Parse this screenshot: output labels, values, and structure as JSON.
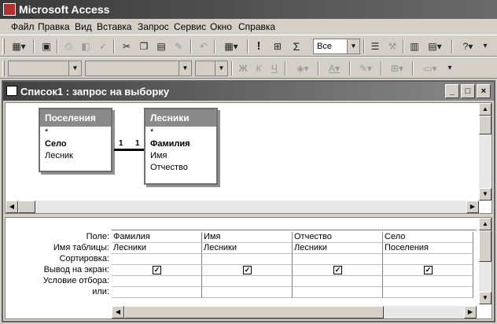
{
  "app": {
    "title": "Microsoft Access"
  },
  "menu": [
    {
      "label": "Файл"
    },
    {
      "label": "Правка"
    },
    {
      "label": "Вид"
    },
    {
      "label": "Вставка"
    },
    {
      "label": "Запрос"
    },
    {
      "label": "Сервис"
    },
    {
      "label": "Окно"
    },
    {
      "label": "Справка"
    }
  ],
  "toolbar": {
    "query_type": "Все",
    "sigma": "Σ",
    "run": "!"
  },
  "format_toolbar": {
    "bold": "Ж",
    "italic": "К",
    "underline": "Ч"
  },
  "query_window": {
    "title": "Список1 : запрос на выборку",
    "min": "_",
    "max": "□",
    "close": "×"
  },
  "tables": [
    {
      "name": "Поселения",
      "fields": [
        "*",
        "Село",
        "Лесник"
      ]
    },
    {
      "name": "Лесники",
      "fields": [
        "*",
        "Фамилия",
        "Имя",
        "Отчество"
      ]
    }
  ],
  "join": {
    "left_label": "1",
    "right_label": "1"
  },
  "grid": {
    "row_labels": [
      "Поле:",
      "Имя таблицы:",
      "Сортировка:",
      "Вывод на экран:",
      "Условие отбора:",
      "или:"
    ],
    "columns": [
      {
        "field": "Фамилия",
        "table": "Лесники",
        "show": true
      },
      {
        "field": "Имя",
        "table": "Лесники",
        "show": true
      },
      {
        "field": "Отчество",
        "table": "Лесники",
        "show": true
      },
      {
        "field": "Село",
        "table": "Поселения",
        "show": true
      }
    ]
  }
}
